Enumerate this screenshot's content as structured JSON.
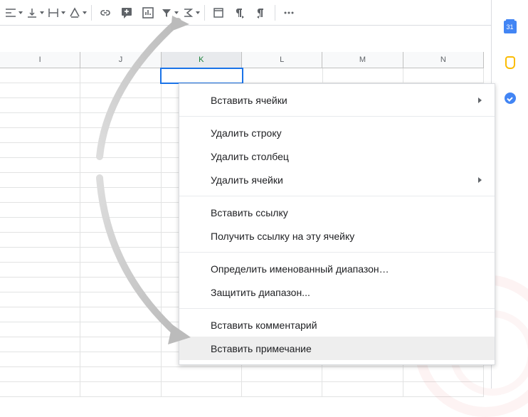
{
  "toolbar": {
    "icons": [
      "horizontal-align",
      "vertical-align",
      "text-wrap",
      "text-rotation",
      "insert-link",
      "insert-comment",
      "insert-chart",
      "create-filter",
      "functions",
      "format-1",
      "format-2",
      "format-3",
      "more"
    ],
    "collapse": "collapse-toolbar"
  },
  "columns": [
    "I",
    "J",
    "K",
    "L",
    "M",
    "N"
  ],
  "selected_column_index": 2,
  "selected_row_index": 0,
  "row_count": 22,
  "sidebar": {
    "calendar_day": "31"
  },
  "context_menu": [
    {
      "label": "Вставить ячейки",
      "submenu": true
    },
    {
      "sep": true
    },
    {
      "label": "Удалить строку"
    },
    {
      "label": "Удалить столбец"
    },
    {
      "label": "Удалить ячейки",
      "submenu": true
    },
    {
      "sep": true
    },
    {
      "label": "Вставить ссылку"
    },
    {
      "label": "Получить ссылку на эту ячейку"
    },
    {
      "sep": true
    },
    {
      "label": "Определить именованный диапазон…"
    },
    {
      "label": "Защитить диапазон..."
    },
    {
      "sep": true
    },
    {
      "label": "Вставить комментарий"
    },
    {
      "label": "Вставить примечание",
      "hover": true
    }
  ]
}
